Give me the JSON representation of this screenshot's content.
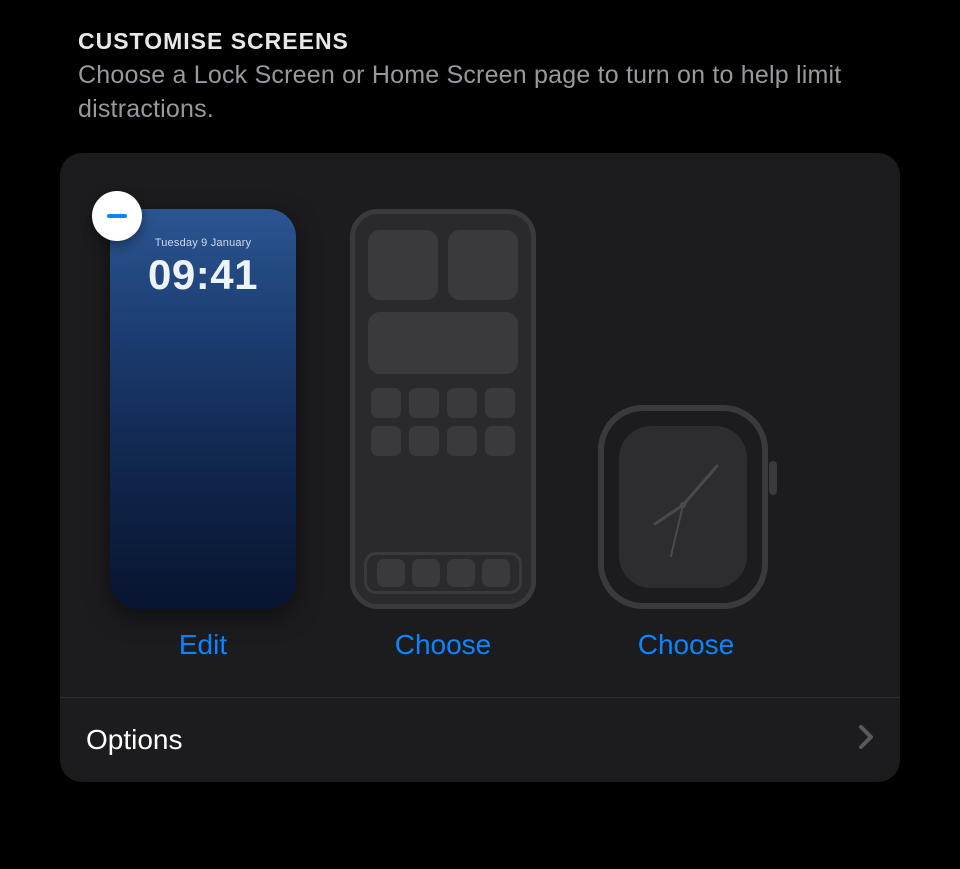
{
  "section": {
    "title": "CUSTOMISE SCREENS",
    "subtitle": "Choose a Lock Screen or Home Screen page to turn on to help limit distractions."
  },
  "lock_screen": {
    "date": "Tuesday 9 January",
    "time": "09:41",
    "action_label": "Edit"
  },
  "home_screen": {
    "action_label": "Choose"
  },
  "watch": {
    "action_label": "Choose"
  },
  "options": {
    "label": "Options"
  },
  "colors": {
    "accent": "#0a84ff",
    "card_bg": "#1c1c1e",
    "placeholder": "#3a3a3c"
  }
}
